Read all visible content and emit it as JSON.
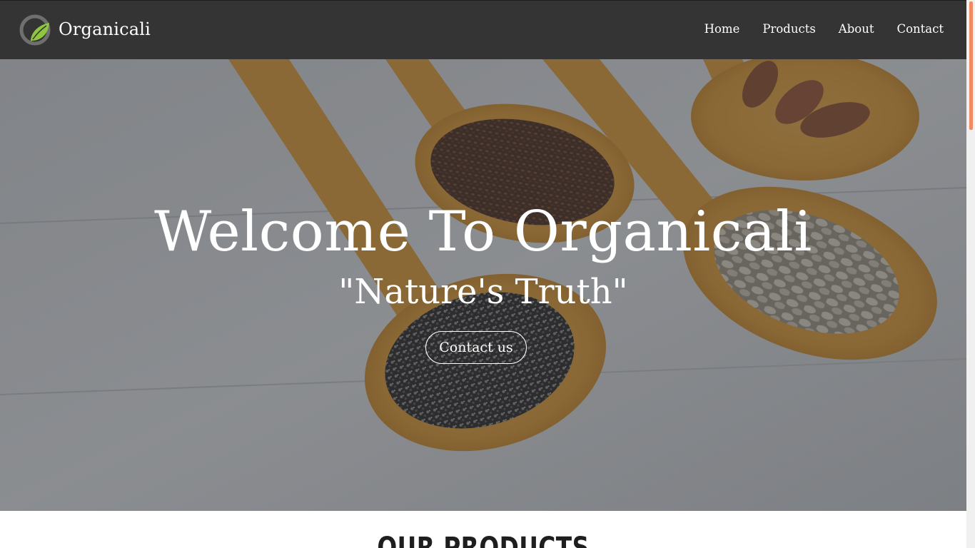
{
  "navbar": {
    "brand_name": "Organicali",
    "logo_icon": "leaf-o-logo-icon",
    "links": [
      "Home",
      "Products",
      "About",
      "Contact"
    ]
  },
  "hero": {
    "title": "Welcome To Organicali",
    "subtitle": "\"Nature's Truth\"",
    "cta_label": "Contact us",
    "background_image": "wooden-spoons-seeds-image"
  },
  "products": {
    "heading": "OUR PRODUCTS"
  },
  "colors": {
    "navbar_bg": "#343434",
    "logo_leaf": "#8ec63f",
    "scroll_thumb": "#f08a62"
  }
}
